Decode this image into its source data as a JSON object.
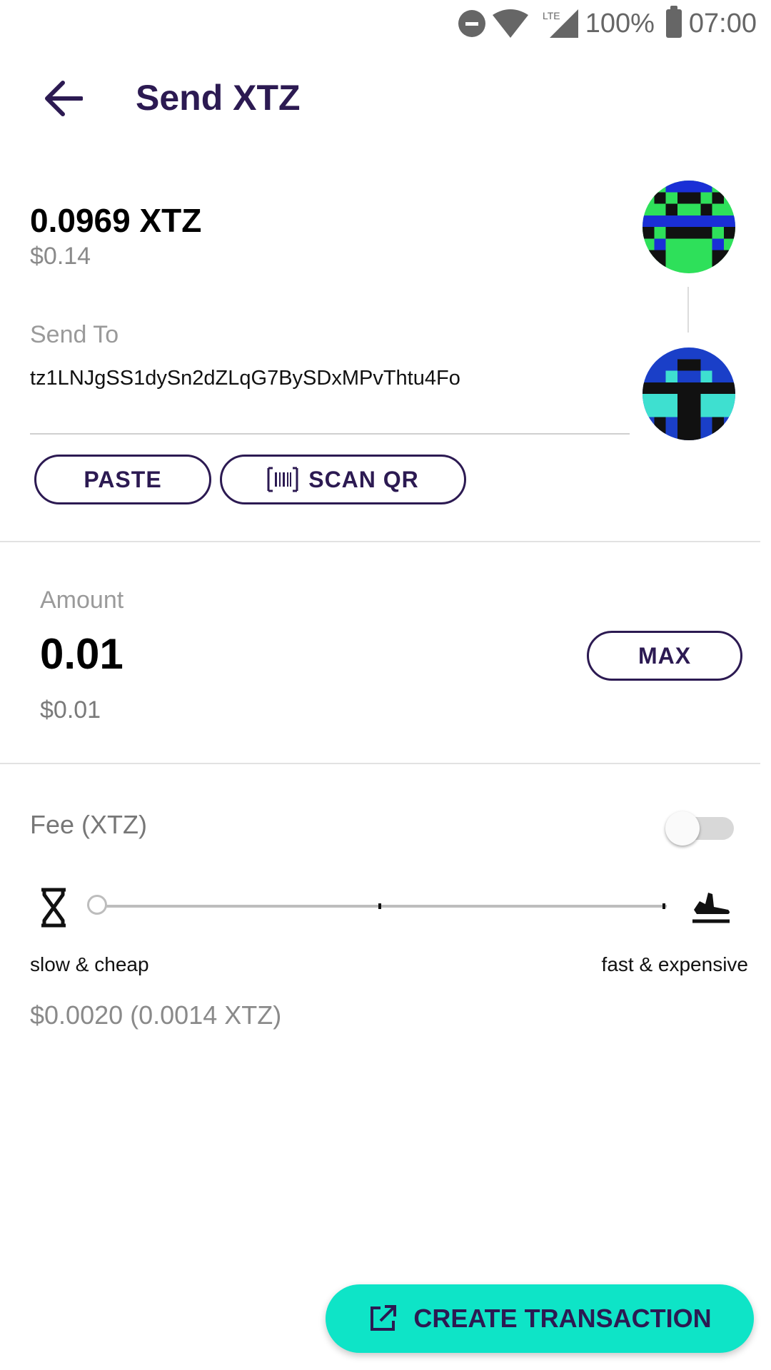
{
  "status_bar": {
    "battery": "100%",
    "time": "07:00",
    "network": "LTE"
  },
  "header": {
    "title": "Send XTZ"
  },
  "balance": {
    "amount": "0.0969 XTZ",
    "fiat": "$0.14"
  },
  "send_to": {
    "label": "Send To",
    "address": "tz1LNJgSS1dySn2dZLqG7BySDxMPvThtu4Fo",
    "paste_label": "PASTE",
    "scan_label": "SCAN QR"
  },
  "amount": {
    "label": "Amount",
    "value": "0.01",
    "fiat": "$0.01",
    "max_label": "MAX"
  },
  "fee": {
    "label": "Fee (XTZ)",
    "toggle_on": false,
    "slider_level": 0,
    "slow_label": "slow & cheap",
    "fast_label": "fast & expensive",
    "value": "$0.0020 (0.0014 XTZ)"
  },
  "footer": {
    "create_label": "CREATE TRANSACTION"
  },
  "colors": {
    "primary": "#2c1a52",
    "accent": "#0ee4c7"
  },
  "icons": [
    "back-arrow-icon",
    "barcode-icon",
    "hourglass-icon",
    "airplane-icon",
    "external-link-icon",
    "wifi-icon",
    "signal-icon",
    "battery-icon",
    "dnd-icon"
  ]
}
